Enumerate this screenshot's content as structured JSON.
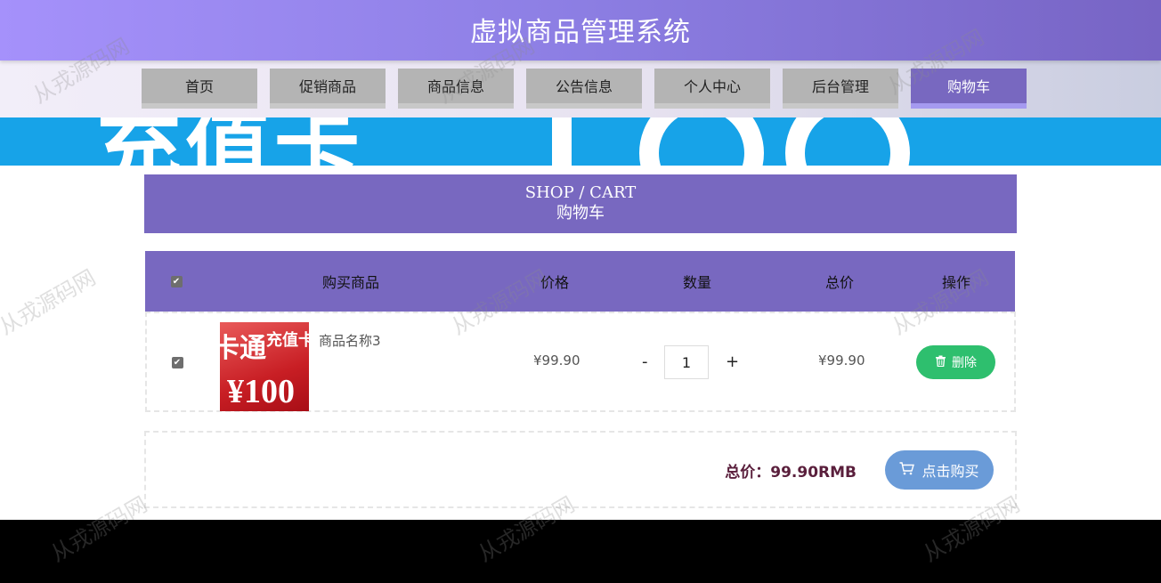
{
  "header": {
    "title": "虚拟商品管理系统"
  },
  "nav": {
    "items": [
      {
        "label": "首页"
      },
      {
        "label": "促销商品"
      },
      {
        "label": "商品信息"
      },
      {
        "label": "公告信息"
      },
      {
        "label": "个人中心"
      },
      {
        "label": "后台管理"
      },
      {
        "label": "购物车"
      }
    ],
    "active_index": 6
  },
  "section": {
    "title_en": "SHOP / CART",
    "title_zh": "购物车"
  },
  "cart": {
    "columns": [
      "购买商品",
      "价格",
      "数量",
      "总价",
      "操作"
    ],
    "rows": [
      {
        "image_text_1": "卡通",
        "image_text_2": "充值卡",
        "image_text_3": "¥100",
        "name": "商品名称3",
        "price": "¥99.90",
        "quantity": "1",
        "subtotal": "¥99.90",
        "delete_label": "删除"
      }
    ],
    "minus": "-",
    "plus": "+"
  },
  "summary": {
    "total": "总价：99.90RMB",
    "buy_label": "点击购买"
  },
  "watermark": "从戎源码网",
  "colors": {
    "accent": "#7868c0",
    "banner": "#17a3e8",
    "delete": "#2ebf6e",
    "buy": "#6a9bd8"
  }
}
